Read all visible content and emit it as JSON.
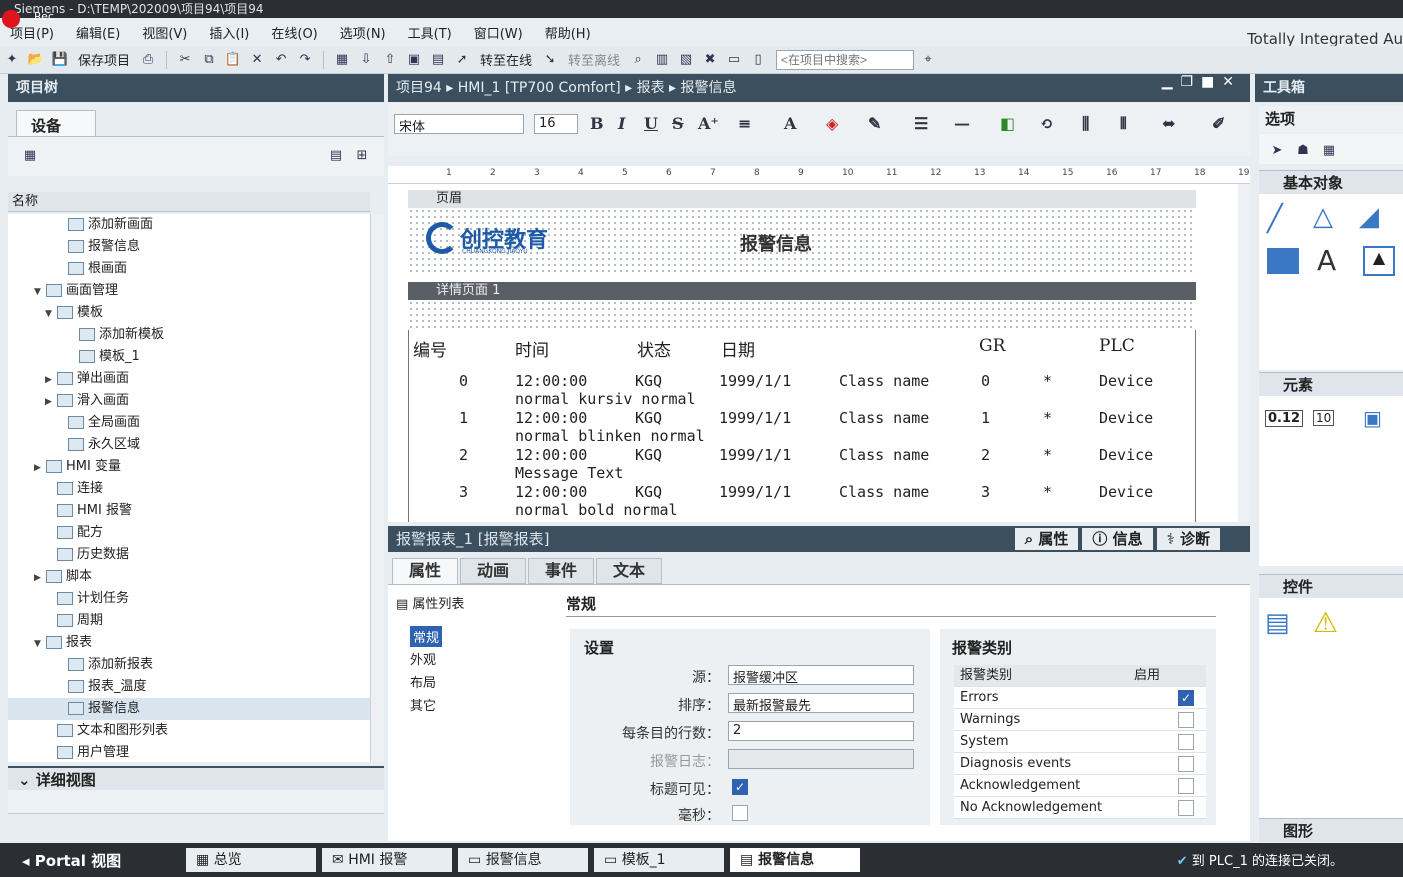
{
  "window": {
    "title": "Siemens  -  D:\\TEMP\\202009\\项目94\\项目94",
    "rec": "Rec"
  },
  "menu": [
    "项目(P)",
    "编辑(E)",
    "视图(V)",
    "插入(I)",
    "在线(O)",
    "选项(N)",
    "工具(T)",
    "窗口(W)",
    "帮助(H)"
  ],
  "brand": "Totally Integrated Au",
  "toolbar": {
    "save": "保存项目",
    "go_online": "转至在线",
    "go_offline": "转至离线",
    "search_placeholder": "<在项目中搜索>"
  },
  "left": {
    "title": "项目树",
    "tab": "设备",
    "column": "名称",
    "tree": [
      {
        "label": "添加新画面",
        "indent": 4,
        "expand": ""
      },
      {
        "label": "报警信息",
        "indent": 4,
        "expand": ""
      },
      {
        "label": "根画面",
        "indent": 4,
        "expand": ""
      },
      {
        "label": "画面管理",
        "indent": 2,
        "expand": "▼"
      },
      {
        "label": "模板",
        "indent": 3,
        "expand": "▼"
      },
      {
        "label": "添加新模板",
        "indent": 5,
        "expand": ""
      },
      {
        "label": "模板_1",
        "indent": 5,
        "expand": ""
      },
      {
        "label": "弹出画面",
        "indent": 3,
        "expand": "▶"
      },
      {
        "label": "滑入画面",
        "indent": 3,
        "expand": "▶"
      },
      {
        "label": "全局画面",
        "indent": 4,
        "expand": ""
      },
      {
        "label": "永久区域",
        "indent": 4,
        "expand": ""
      },
      {
        "label": "HMI 变量",
        "indent": 2,
        "expand": "▶"
      },
      {
        "label": "连接",
        "indent": 3,
        "expand": ""
      },
      {
        "label": "HMI 报警",
        "indent": 3,
        "expand": ""
      },
      {
        "label": "配方",
        "indent": 3,
        "expand": ""
      },
      {
        "label": "历史数据",
        "indent": 3,
        "expand": ""
      },
      {
        "label": "脚本",
        "indent": 2,
        "expand": "▶"
      },
      {
        "label": "计划任务",
        "indent": 3,
        "expand": ""
      },
      {
        "label": "周期",
        "indent": 3,
        "expand": ""
      },
      {
        "label": "报表",
        "indent": 2,
        "expand": "▼"
      },
      {
        "label": "添加新报表",
        "indent": 4,
        "expand": ""
      },
      {
        "label": "报表_温度",
        "indent": 4,
        "expand": ""
      },
      {
        "label": "报警信息",
        "indent": 4,
        "expand": "",
        "selected": true
      },
      {
        "label": "文本和图形列表",
        "indent": 3,
        "expand": ""
      },
      {
        "label": "用户管理",
        "indent": 3,
        "expand": ""
      }
    ],
    "detail": "详细视图"
  },
  "editor": {
    "breadcrumb": [
      "项目94",
      "HMI_1 [TP700 Comfort]",
      "报表",
      "报警信息"
    ],
    "font": "宋体",
    "size": "16",
    "header_band": "页眉",
    "detail_band": "详情页面 1",
    "logo_text": "创控教育",
    "logo_sub": "CHUANGKONG JIAOYU",
    "report_title": "报警信息",
    "ruler": [
      "1",
      "2",
      "3",
      "4",
      "5",
      "6",
      "7",
      "8",
      "9",
      "10",
      "11",
      "12",
      "13",
      "14",
      "15",
      "16",
      "17",
      "18",
      "19"
    ],
    "columns": [
      "编号",
      "时间",
      "状态",
      "日期",
      "GR",
      "PLC"
    ],
    "rows": [
      {
        "no": "0",
        "time": "12:00:00",
        "state": "KGQ",
        "date": "1999/1/1",
        "cls": "Class name",
        "gr": "0",
        "star": "*",
        "plc": "Device",
        "text": "normal kursiv normal"
      },
      {
        "no": "1",
        "time": "12:00:00",
        "state": "KGQ",
        "date": "1999/1/1",
        "cls": "Class name",
        "gr": "1",
        "star": "*",
        "plc": "Device",
        "text": "normal blinken normal"
      },
      {
        "no": "2",
        "time": "12:00:00",
        "state": "KGQ",
        "date": "1999/1/1",
        "cls": "Class name",
        "gr": "2",
        "star": "*",
        "plc": "Device",
        "text": "Message Text"
      },
      {
        "no": "3",
        "time": "12:00:00",
        "state": "KGQ",
        "date": "1999/1/1",
        "cls": "Class name",
        "gr": "3",
        "star": "*",
        "plc": "Device",
        "text": "normal bold normal"
      }
    ]
  },
  "props": {
    "title": "报警报表_1 [报警报表]",
    "right_tabs": [
      "属性",
      "信息",
      "诊断"
    ],
    "tabs": [
      "属性",
      "动画",
      "事件",
      "文本"
    ],
    "list_title": "属性列表",
    "list": [
      "常规",
      "外观",
      "布局",
      "其它"
    ],
    "section": "常规",
    "settings_title": "设置",
    "fields": [
      {
        "label": "源：",
        "value": "报警缓冲区"
      },
      {
        "label": "排序：",
        "value": "最新报警最先"
      },
      {
        "label": "每条目的行数：",
        "value": "2"
      },
      {
        "label": "报警日志：",
        "value": ""
      }
    ],
    "title_visible_label": "标题可见：",
    "ms_label": "毫秒：",
    "cat_title": "报警类别",
    "cat_col1": "报警类别",
    "cat_col2": "启用",
    "categories": [
      {
        "name": "Errors",
        "on": true
      },
      {
        "name": "Warnings",
        "on": false
      },
      {
        "name": "System",
        "on": false
      },
      {
        "name": "Diagnosis events",
        "on": false
      },
      {
        "name": "Acknowledgement",
        "on": false
      },
      {
        "name": "No Acknowledgement",
        "on": false
      }
    ]
  },
  "right": {
    "title": "工具箱",
    "options": "选项",
    "basic": "基本对象",
    "elements": "元素",
    "controls": "控件",
    "graphics": "图形",
    "io_label": "0.12",
    "combo_label": "10"
  },
  "status": {
    "portal": "Portal 视图",
    "tasks": [
      "总览",
      "HMI 报警",
      "报警信息",
      "模板_1",
      "报警信息"
    ],
    "message": "到 PLC_1 的连接已关闭。"
  }
}
